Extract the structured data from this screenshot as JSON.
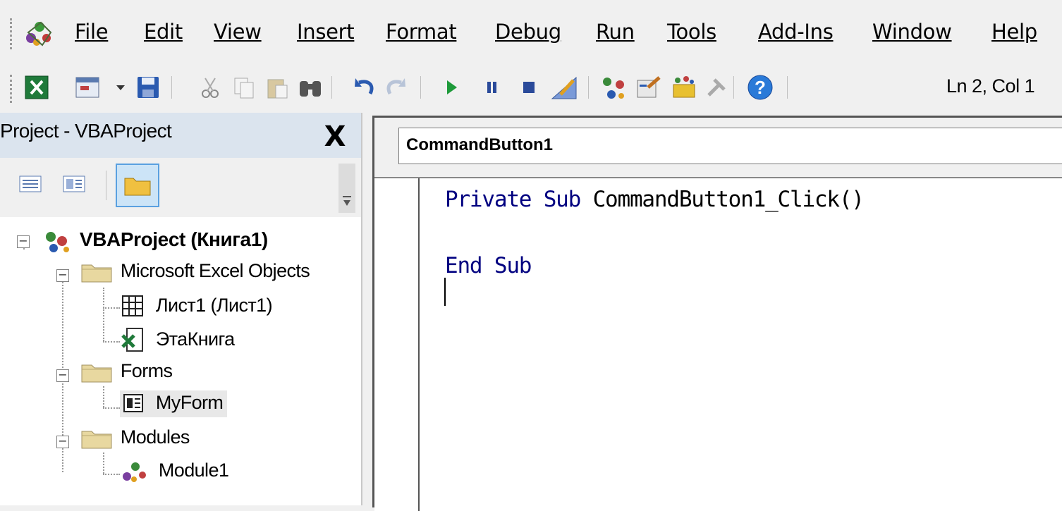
{
  "menubar": {
    "items": [
      {
        "label": "File"
      },
      {
        "label": "Edit"
      },
      {
        "label": "View"
      },
      {
        "label": "Insert"
      },
      {
        "label": "Format"
      },
      {
        "label": "Debug"
      },
      {
        "label": "Run"
      },
      {
        "label": "Tools"
      },
      {
        "label": "Add-Ins"
      },
      {
        "label": "Window"
      },
      {
        "label": "Help"
      }
    ]
  },
  "toolbar": {
    "icons": [
      "excel-icon",
      "insert-userform-icon",
      "dropdown-arrow-icon",
      "save-icon",
      "cut-icon",
      "copy-icon",
      "paste-icon",
      "find-icon",
      "undo-icon",
      "redo-icon",
      "run-icon",
      "break-icon",
      "reset-icon",
      "design-mode-icon",
      "project-explorer-icon",
      "properties-icon",
      "object-browser-icon",
      "toolbox-icon",
      "help-icon"
    ],
    "status": "Ln 2, Col 1"
  },
  "project_pane": {
    "title": "Project - VBAProject",
    "close": "X",
    "tree": {
      "root": "VBAProject (Книга1)",
      "folders": [
        {
          "label": "Microsoft Excel Objects",
          "items": [
            "Лист1 (Лист1)",
            "ЭтаКнига"
          ]
        },
        {
          "label": "Forms",
          "items": [
            "MyForm"
          ]
        },
        {
          "label": "Modules",
          "items": [
            "Module1"
          ]
        }
      ]
    }
  },
  "code_window": {
    "object": "CommandButton1",
    "lines": {
      "line1_kw": "Private Sub",
      "line1_rest": " CommandButton1_Click()",
      "line3": "End Sub"
    }
  },
  "colors": {
    "keyword": "#000080",
    "pane_header": "#dbe4ee"
  }
}
